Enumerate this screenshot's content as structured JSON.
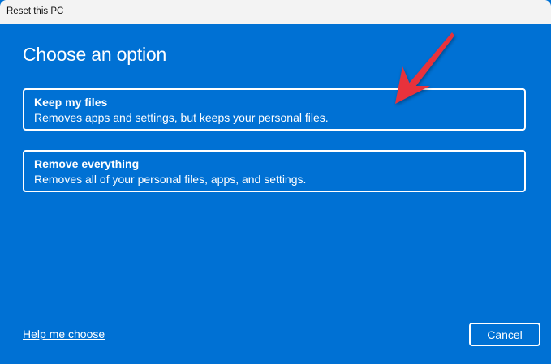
{
  "window": {
    "title": "Reset this PC"
  },
  "main": {
    "heading": "Choose an option",
    "options": [
      {
        "title": "Keep my files",
        "description": "Removes apps and settings, but keeps your personal files."
      },
      {
        "title": "Remove everything",
        "description": "Removes all of your personal files, apps, and settings."
      }
    ],
    "help_link": "Help me choose",
    "cancel_label": "Cancel"
  },
  "annotation": {
    "arrow_color": "#e8333a"
  },
  "colors": {
    "background": "#0071d4",
    "titlebar": "#f3f3f3"
  }
}
